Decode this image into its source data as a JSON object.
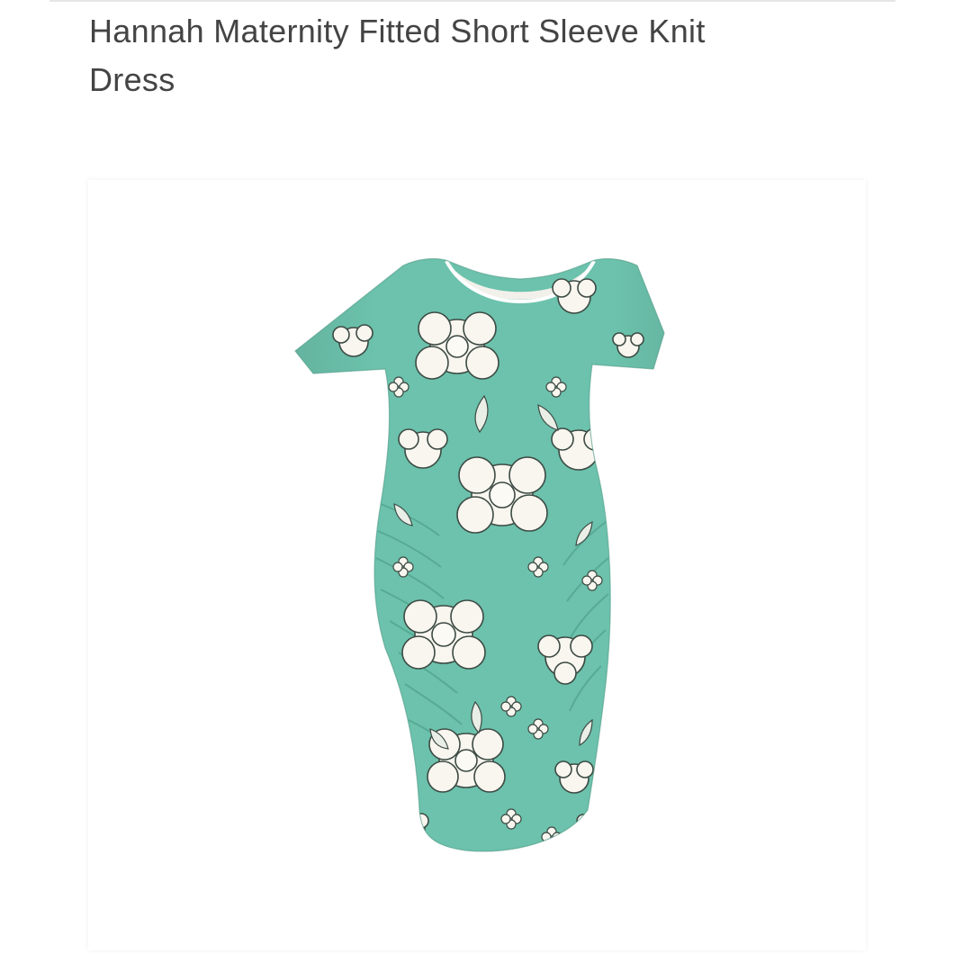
{
  "product": {
    "title": "Hannah Maternity Fitted Short Sleeve Knit Dress",
    "image": {
      "subject": "dress-icon",
      "colors": {
        "base": "#6cc2ac",
        "flower": "#f8f6ef",
        "outline": "#3d4a44",
        "leaf": "#e9eee6"
      }
    }
  }
}
